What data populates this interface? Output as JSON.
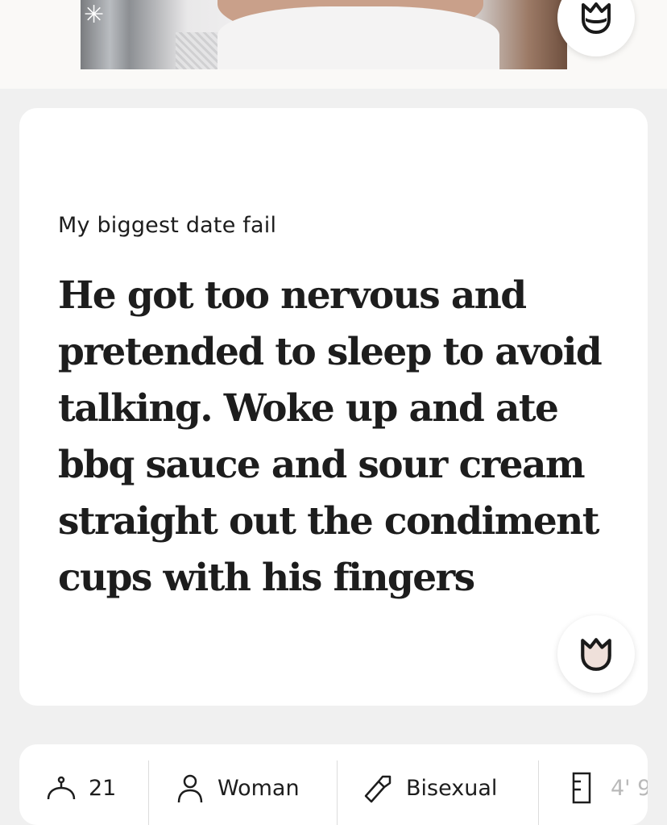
{
  "prompt": {
    "label": "My biggest date fail",
    "answer": "He got too nervous and pretended to sleep to avoid talking. Woke up and ate bbq sauce and sour cream straight out the condiment cups with his fingers"
  },
  "info": {
    "age": "21",
    "gender": "Woman",
    "sexuality": "Bisexual",
    "height": "4' 9"
  },
  "icons": {
    "like": "rose-icon",
    "age": "cake-icon",
    "gender": "person-icon",
    "sexuality": "sexuality-icon",
    "height": "ruler-icon"
  },
  "colors": {
    "background": "#f0f0f0",
    "card": "#ffffff",
    "text": "#1d1d1d",
    "rose_fill": "#efe0da"
  }
}
